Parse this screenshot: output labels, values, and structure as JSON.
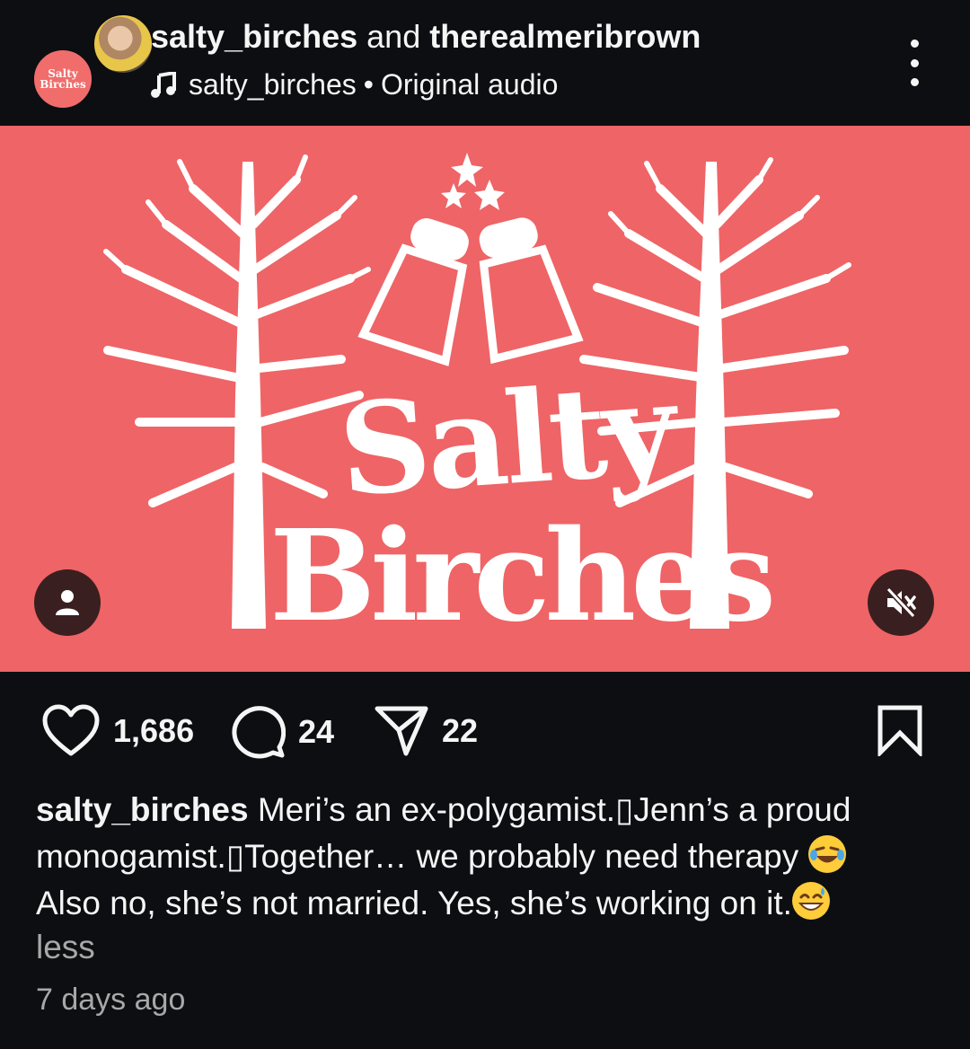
{
  "header": {
    "author": "salty_birches",
    "joiner": "and",
    "collaborator": "therealmeribrown",
    "audio_user": "salty_birches",
    "audio_separator": "•",
    "audio_label": "Original audio",
    "avatar_text": "Salty Birches"
  },
  "media": {
    "logo_line1": "Salty",
    "logo_line2": "Birches",
    "background_color": "#ef6466",
    "icons": [
      "user-tag-icon",
      "muted-speaker-icon"
    ]
  },
  "actions": {
    "likes": "1,686",
    "comments": "24",
    "shares": "22",
    "icons": [
      "heart-icon",
      "comment-icon",
      "share-icon",
      "bookmark-icon"
    ]
  },
  "caption": {
    "username": "salty_birches",
    "line1": "Meri’s an ex-polygamist.▯Jenn’s a proud",
    "line2": "monogamist.▯Together… we probably need therapy",
    "line3": "Also no, she’s not married. Yes, she’s working on it.",
    "less_label": "less"
  },
  "timestamp": "7 days ago",
  "colors": {
    "background": "#0c0e12",
    "accent": "#ef6466",
    "muted_text": "#a8a8a8"
  }
}
